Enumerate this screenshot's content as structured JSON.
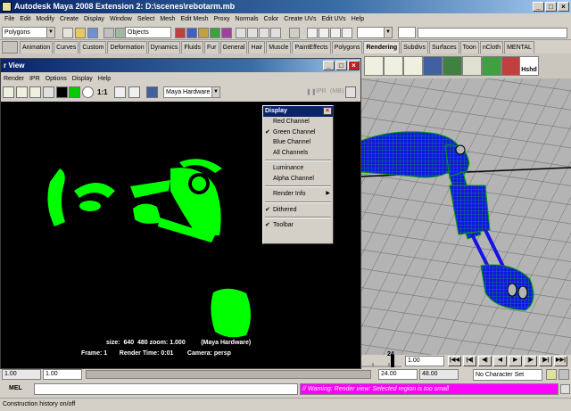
{
  "app": {
    "title": "Autodesk Maya 2008 Extension 2: D:\\scenes\\rebotarm.mb",
    "menus": [
      "File",
      "Edit",
      "Modify",
      "Create",
      "Display",
      "Window",
      "Select",
      "Mesh",
      "Edit Mesh",
      "Proxy",
      "Normals",
      "Color",
      "Create UVs",
      "Edit UVs",
      "Help"
    ]
  },
  "statusline": {
    "menu_set": "Polygons",
    "objects_label": "Objects"
  },
  "shelf": {
    "tabs": [
      "Animation",
      "Curves",
      "Custom",
      "Deformation",
      "Dynamics",
      "Fluids",
      "Fur",
      "General",
      "Hair",
      "Muscle",
      "PaintEffects",
      "Polygons",
      "Rendering",
      "Subdivs",
      "Surfaces",
      "Toon",
      "nCloth",
      "MENTAL"
    ],
    "selected_tab": "Rendering",
    "hshd_label": "Hshd"
  },
  "render_view": {
    "title": "r View",
    "menus": [
      "Render",
      "IPR",
      "Options",
      "Display",
      "Help"
    ],
    "ratio_label": "1:1",
    "renderer": "Maya Hardware",
    "ipr_label": "IPR",
    "ipr_size": "(MB)",
    "info_line1": "size:  640  480 zoom: 1.000         (Maya Hardware)",
    "info_line2": "Frame: 1       Render Time: 0:01        Camera: persp"
  },
  "display_menu": {
    "title": "Display",
    "groups": [
      [
        {
          "label": "Red Channel",
          "checked": false
        },
        {
          "label": "Green Channel",
          "checked": true
        },
        {
          "label": "Blue Channel",
          "checked": false
        },
        {
          "label": "All Channels",
          "checked": false
        }
      ],
      [
        {
          "label": "Luminance",
          "checked": false
        },
        {
          "label": "Alpha Channel",
          "checked": false
        }
      ],
      [
        {
          "label": "Render Info",
          "checked": false,
          "submenu": true
        }
      ],
      [
        {
          "label": "Dithered",
          "checked": true
        }
      ],
      [
        {
          "label": "Toolbar",
          "checked": true
        }
      ]
    ]
  },
  "timeline": {
    "current_frame": "24",
    "current_field": "1.00"
  },
  "range": {
    "start": "1.00",
    "start2": "1.00",
    "end": "24.00",
    "end2": "48.00",
    "character_set": "No Character Set"
  },
  "command": {
    "label": "MEL",
    "feedback": "// Warning: Render view: Selected region is too small"
  },
  "help_line": "Construction history on/off",
  "colors": {
    "title_blue": "#0a246a",
    "render_green": "#00ff00",
    "viewport_gray": "#b4b4b4",
    "mesh_blue": "#1414e6",
    "feedback_magenta": "#ff00ff"
  }
}
